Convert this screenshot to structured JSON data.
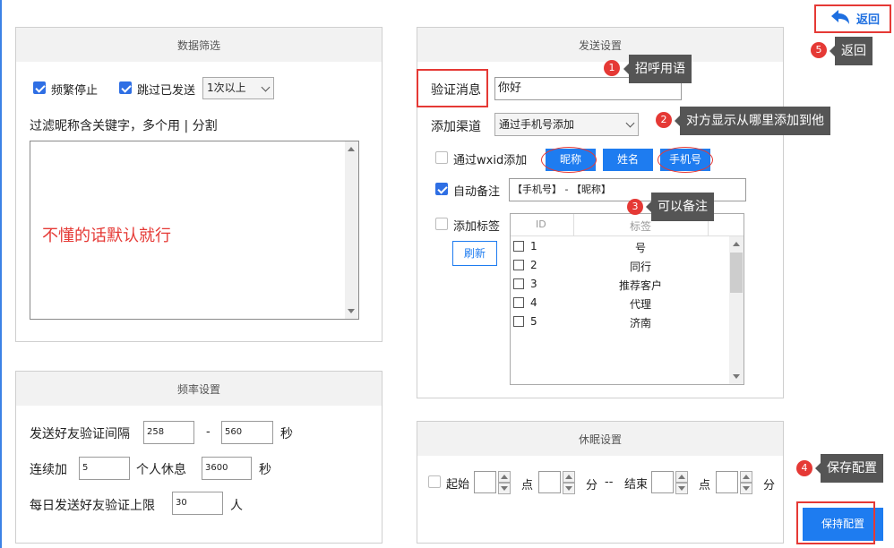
{
  "back": {
    "label": "返回"
  },
  "filter": {
    "title": "数据筛选",
    "freq_stop": "频繁停止",
    "skip_sent": "跳过已发送",
    "times_option": "1次以上",
    "nickname_filter_label": "过滤昵称含关键字，多个用 | 分割",
    "hint": "不懂的话默认就行"
  },
  "send": {
    "title": "发送设置",
    "verify_label": "验证消息",
    "verify_value": "你好",
    "channel_label": "添加渠道",
    "channel_value": "通过手机号添加",
    "wxid_label": "通过wxid添加",
    "btn_nickname": "昵称",
    "btn_name": "姓名",
    "btn_phone": "手机号",
    "auto_remark_label": "自动备注",
    "auto_remark_value": "【手机号】 - 【昵称】",
    "add_tag_label": "添加标签",
    "refresh": "刷新",
    "table": {
      "col_id": "ID",
      "col_tag": "标签",
      "rows": [
        {
          "id": "1",
          "tag": "号"
        },
        {
          "id": "2",
          "tag": "同行"
        },
        {
          "id": "3",
          "tag": "推荐客户"
        },
        {
          "id": "4",
          "tag": "代理"
        },
        {
          "id": "5",
          "tag": "济南"
        }
      ]
    }
  },
  "rate": {
    "title": "频率设置",
    "interval_label": "发送好友验证间隔",
    "interval_min": "258",
    "interval_dash": "-",
    "interval_max": "560",
    "sec": "秒",
    "continuous_label": "连续加",
    "continuous_value": "5",
    "rest_label": "个人休息",
    "rest_value": "3600",
    "limit_label": "每日发送好友验证上限",
    "limit_value": "30",
    "person": "人"
  },
  "sleep": {
    "title": "休眠设置",
    "start": "起始",
    "hour": "点",
    "minute": "分",
    "sep": "--",
    "end": "结束"
  },
  "save_button": "保持配置",
  "annotations": [
    {
      "num": "1",
      "text": "招呼用语"
    },
    {
      "num": "2",
      "text": "对方显示从哪里添加到他"
    },
    {
      "num": "3",
      "text": "可以备注"
    },
    {
      "num": "4",
      "text": "保存配置"
    },
    {
      "num": "5",
      "text": "返回"
    }
  ],
  "colors": {
    "accent": "#1e7cf0",
    "annotation_red": "#e53935",
    "tooltip_gray": "#555555"
  }
}
